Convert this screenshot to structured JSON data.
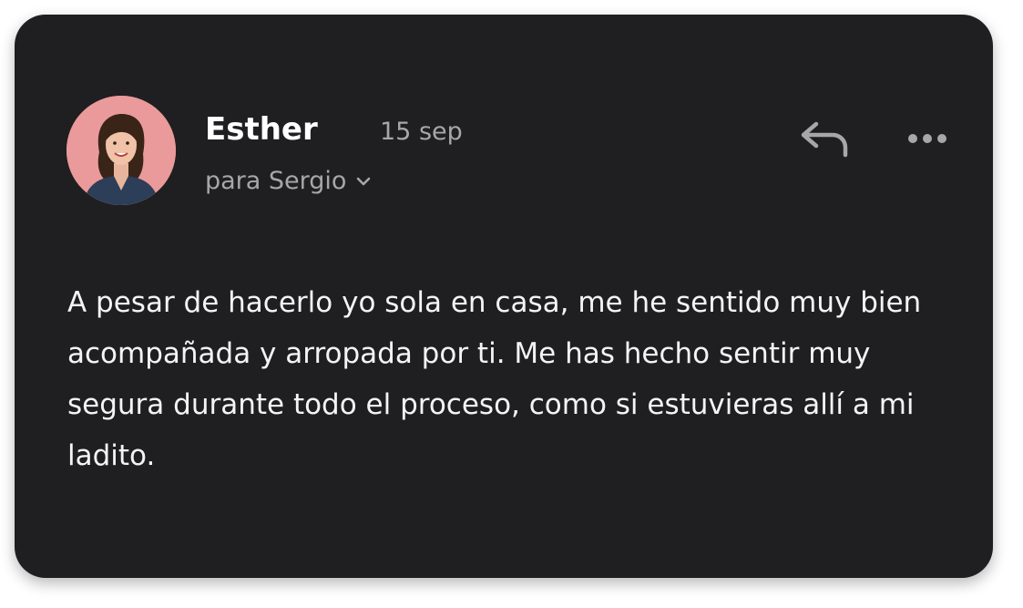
{
  "message": {
    "sender": "Esther",
    "date": "15 sep",
    "recipient": "para Sergio",
    "body": "A pesar de hacerlo yo sola en casa, me he sentido muy bien acompañada y arropada por ti. Me has hecho sentir muy segura durante todo el proceso, como si estuvieras allí a mi ladito."
  },
  "icons": {
    "avatar": "avatar-photo",
    "recipient_toggle": "chevron-down-icon",
    "reply": "reply-icon",
    "more": "more-horizontal-icon"
  },
  "colors": {
    "card_background": "#1f1f21",
    "avatar_background": "#ea9a9a",
    "primary_text": "#ffffff",
    "secondary_text": "#a7a7a9"
  }
}
